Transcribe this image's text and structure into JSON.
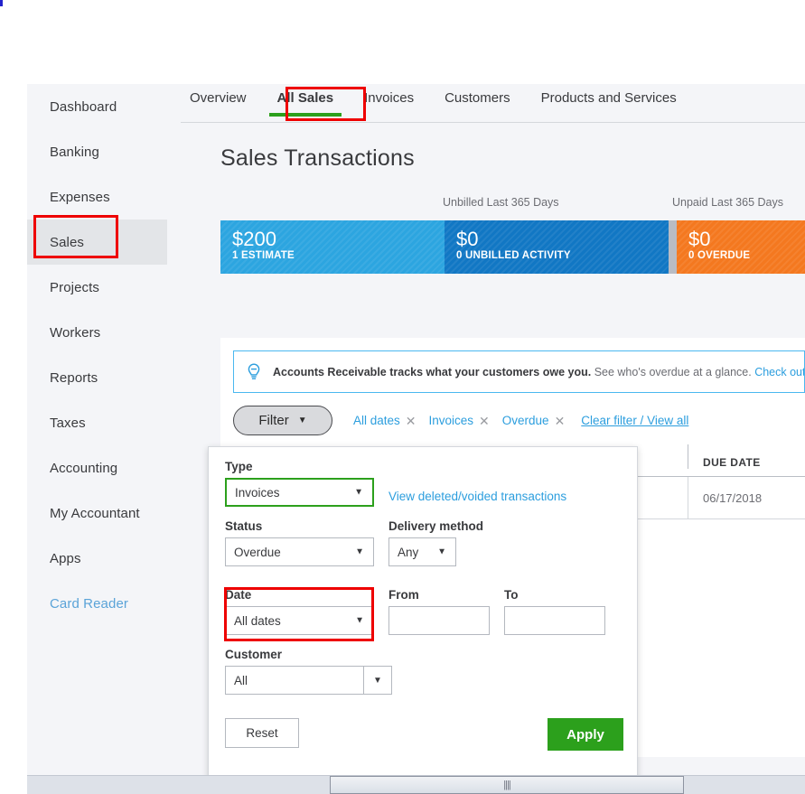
{
  "app": {
    "page_title": "Sales Transactions"
  },
  "sidebar": {
    "items": [
      {
        "label": "Dashboard",
        "state": "normal"
      },
      {
        "label": "Banking",
        "state": "normal"
      },
      {
        "label": "Expenses",
        "state": "normal"
      },
      {
        "label": "Sales",
        "state": "active"
      },
      {
        "label": "Projects",
        "state": "normal"
      },
      {
        "label": "Workers",
        "state": "normal"
      },
      {
        "label": "Reports",
        "state": "normal"
      },
      {
        "label": "Taxes",
        "state": "normal"
      },
      {
        "label": "Accounting",
        "state": "normal"
      },
      {
        "label": "My Accountant",
        "state": "normal"
      },
      {
        "label": "Apps",
        "state": "normal"
      },
      {
        "label": "Card Reader",
        "state": "link"
      }
    ]
  },
  "tabs": [
    {
      "label": "Overview",
      "active": false
    },
    {
      "label": "All Sales",
      "active": true
    },
    {
      "label": "Invoices",
      "active": false
    },
    {
      "label": "Customers",
      "active": false
    },
    {
      "label": "Products and Services",
      "active": false
    }
  ],
  "money": {
    "label_unbilled": "Unbilled Last 365 Days",
    "label_unpaid": "Unpaid Last 365 Days",
    "bars": [
      {
        "amount": "$200",
        "caption": "1 ESTIMATE",
        "color": "#2ca5e0"
      },
      {
        "amount": "$0",
        "caption": "0 UNBILLED ACTIVITY",
        "color": "#1177c4"
      },
      {
        "amount": "$0",
        "caption": "0 OVERDUE",
        "color": "#f4781f"
      }
    ]
  },
  "banner": {
    "icon": "lightbulb-icon",
    "strong": "Accounts Receivable tracks what your customers owe you.",
    "muted": " See who's overdue at a glance. ",
    "link": "Check out this vid"
  },
  "filter_row": {
    "filter_button": "Filter",
    "caret": "▼",
    "chips": [
      {
        "label": "All dates",
        "remove": "✕"
      },
      {
        "label": "Invoices",
        "remove": "✕"
      },
      {
        "label": "Overdue",
        "remove": "✕"
      }
    ],
    "clear": "Clear filter / View all"
  },
  "table": {
    "columns": [
      "",
      "DUE DATE"
    ],
    "rows": [
      {
        "due_date": "06/17/2018"
      }
    ]
  },
  "filter_panel": {
    "type": {
      "label": "Type",
      "value": "Invoices",
      "caret": "▼"
    },
    "deleted_link": "View deleted/voided transactions",
    "status": {
      "label": "Status",
      "value": "Overdue",
      "caret": "▼"
    },
    "delivery": {
      "label": "Delivery method",
      "value": "Any",
      "caret": "▼"
    },
    "date": {
      "label": "Date",
      "value": "All dates",
      "caret": "▼"
    },
    "from": {
      "label": "From",
      "value": ""
    },
    "to": {
      "label": "To",
      "value": ""
    },
    "customer": {
      "label": "Customer",
      "value": "All",
      "caret": "▼"
    },
    "reset": "Reset",
    "apply": "Apply"
  },
  "scrollbar": {
    "grip": "||||"
  },
  "colors": {
    "accent_green": "#2ca01c",
    "link_blue": "#2c9ede",
    "annotation_red": "#ee0000",
    "estimate_blue": "#2ca5e0",
    "unbilled_blue": "#1177c4",
    "overdue_orange": "#f4781f"
  }
}
